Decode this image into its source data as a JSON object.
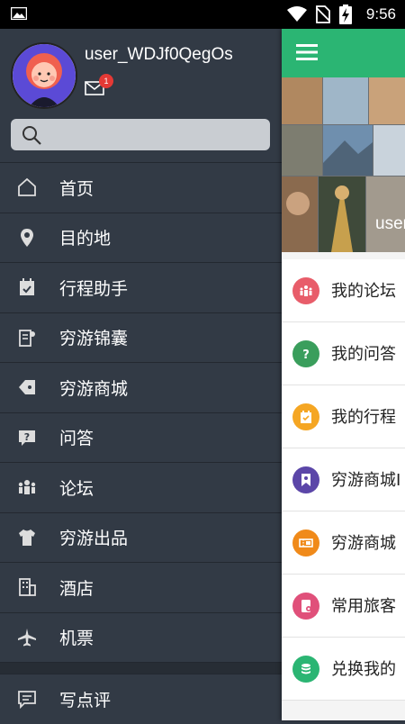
{
  "status_bar": {
    "time": "9:56"
  },
  "drawer": {
    "username": "user_WDJf0QegOs",
    "mail_badge": "1",
    "search_placeholder": "",
    "menu_items": [
      {
        "label": "首页",
        "icon": "home-icon"
      },
      {
        "label": "目的地",
        "icon": "location-pin-icon"
      },
      {
        "label": "行程助手",
        "icon": "calendar-icon"
      },
      {
        "label": "穷游锦囊",
        "icon": "guidebook-icon"
      },
      {
        "label": "穷游商城",
        "icon": "tag-icon"
      },
      {
        "label": "问答",
        "icon": "question-bubble-icon"
      },
      {
        "label": "论坛",
        "icon": "people-icon"
      },
      {
        "label": "穷游出品",
        "icon": "tshirt-icon"
      },
      {
        "label": "酒店",
        "icon": "building-icon"
      },
      {
        "label": "机票",
        "icon": "airplane-icon"
      },
      {
        "label": "写点评",
        "icon": "comment-icon"
      }
    ]
  },
  "main": {
    "hero_username": "user",
    "rows": [
      {
        "label": "我的论坛",
        "color": "#e85d6a",
        "icon": "people-icon"
      },
      {
        "label": "我的问答",
        "color": "#3a9e5c",
        "icon": "question-icon"
      },
      {
        "label": "我的行程",
        "color": "#f5a623",
        "icon": "calendar-icon"
      },
      {
        "label": "穷游商城I",
        "color": "#5b46a8",
        "icon": "bookmark-icon"
      },
      {
        "label": "穷游商城",
        "color": "#f08a1a",
        "icon": "ticket-icon"
      },
      {
        "label": "常用旅客",
        "color": "#e0507a",
        "icon": "passenger-icon"
      },
      {
        "label": "兑换我的",
        "color": "#2bb573",
        "icon": "coins-icon"
      }
    ]
  },
  "colors": {
    "accent_green": "#2bb573",
    "drawer_bg": "#323a45",
    "badge_red": "#e53935"
  }
}
